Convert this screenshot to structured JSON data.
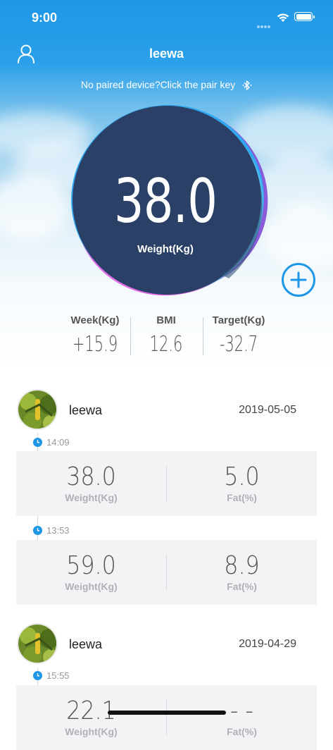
{
  "status_bar": {
    "time": "9:00"
  },
  "header": {
    "title": "leewa",
    "pair_prompt": "No paired device?Click the pair key"
  },
  "current": {
    "weight": "38.0",
    "weight_label": "Weight(Kg)"
  },
  "stats": [
    {
      "label": "Week(Kg)",
      "value": "+15.9"
    },
    {
      "label": "BMI",
      "value": "12.6"
    },
    {
      "label": "Target(Kg)",
      "value": "-32.7"
    }
  ],
  "history": [
    {
      "user": "leewa",
      "date": "2019-05-05",
      "records": [
        {
          "time": "14:09",
          "weight": "38.0",
          "weight_label": "Weight(Kg)",
          "fat": "5.0",
          "fat_label": "Fat(%)"
        },
        {
          "time": "13:53",
          "weight": "59.0",
          "weight_label": "Weight(Kg)",
          "fat": "8.9",
          "fat_label": "Fat(%)"
        }
      ]
    },
    {
      "user": "leewa",
      "date": "2019-04-29",
      "records": [
        {
          "time": "15:55",
          "weight": "22.1",
          "weight_label": "Weight(Kg)",
          "fat": "- -",
          "fat_label": "Fat(%)"
        }
      ]
    }
  ],
  "colors": {
    "primary": "#1e97e6",
    "circle_fill": "#2b4067",
    "circle_blue": "#2fa8f0",
    "circle_purple": "#8a5bd8",
    "circle_pink": "#e16ee8",
    "add_button": "#1e97e6",
    "timeline_clock": "#1e97e6"
  },
  "icons": {
    "profile": "person-outline-icon",
    "pair": "bluetooth-icon",
    "add": "plus-circle-icon",
    "clock": "clock-icon",
    "wifi": "wifi-icon",
    "battery": "battery-icon"
  }
}
